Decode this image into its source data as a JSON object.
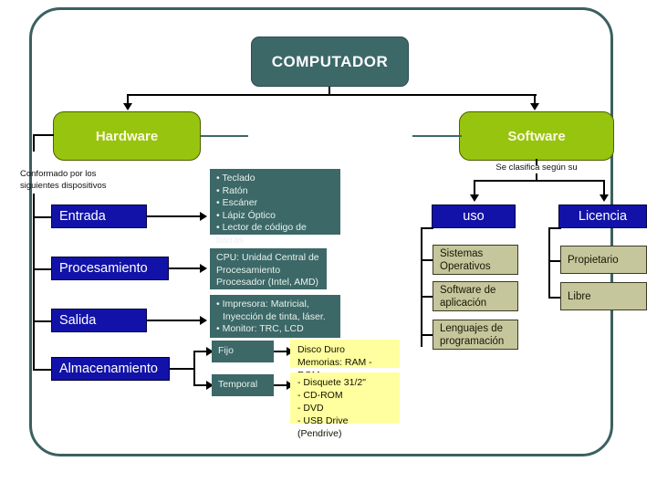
{
  "slide": {
    "title": "COMPUTADOR",
    "frame_color": "#3c6060",
    "colors": {
      "title_box": "#3c6868",
      "green_box": "#97c40e",
      "blue_box": "#1212a8",
      "tan_box": "#c6c69c",
      "yellow_box": "#ffffa0",
      "connector": "#000000"
    }
  },
  "hardware": {
    "label": "Hardware",
    "caption": "Conformado por los\nsiguientes dispositivos",
    "caption_line1": "Conformado por los",
    "caption_line2": "siguientes dispositivos",
    "branches": [
      {
        "label": "Entrada",
        "detail_type": "bullets",
        "detail": [
          "Teclado",
          "Ratón",
          "Escáner",
          "Lápiz Óptico",
          "Lector de código de barras"
        ]
      },
      {
        "label": "Procesamiento",
        "detail_type": "lines",
        "detail": [
          "CPU: Unidad Central de",
          "Procesamiento",
          "Procesador (Intel, AMD)"
        ]
      },
      {
        "label": "Salida",
        "detail_type": "bullets_mixed",
        "detail": [
          "Impresora: Matricial,",
          "Inyección de tinta, láser.",
          "Monitor: TRC, LCD"
        ]
      },
      {
        "label": "Almacenamiento",
        "detail_type": "subbranches",
        "subbranches": [
          {
            "label": "Fijo",
            "notes": [
              "Disco Duro",
              "Memorias: RAM - ROM"
            ]
          },
          {
            "label": "Temporal",
            "notes": [
              "- Disquete 31/2\"",
              "- CD-ROM",
              "- DVD",
              "- USB Drive (Pendrive)"
            ]
          }
        ]
      }
    ]
  },
  "software": {
    "label": "Software",
    "caption": "Se clasifica según su",
    "categories": [
      {
        "label": "uso",
        "items": [
          {
            "line1": "Sistemas",
            "line2": "Operativos"
          },
          {
            "line1": "Software de",
            "line2": "aplicación"
          },
          {
            "line1": "Lenguajes de",
            "line2": "programación"
          }
        ]
      },
      {
        "label": "Licencia",
        "items": [
          {
            "line1": "Propietario",
            "line2": ""
          },
          {
            "line1": "Libre",
            "line2": ""
          }
        ]
      }
    ]
  }
}
